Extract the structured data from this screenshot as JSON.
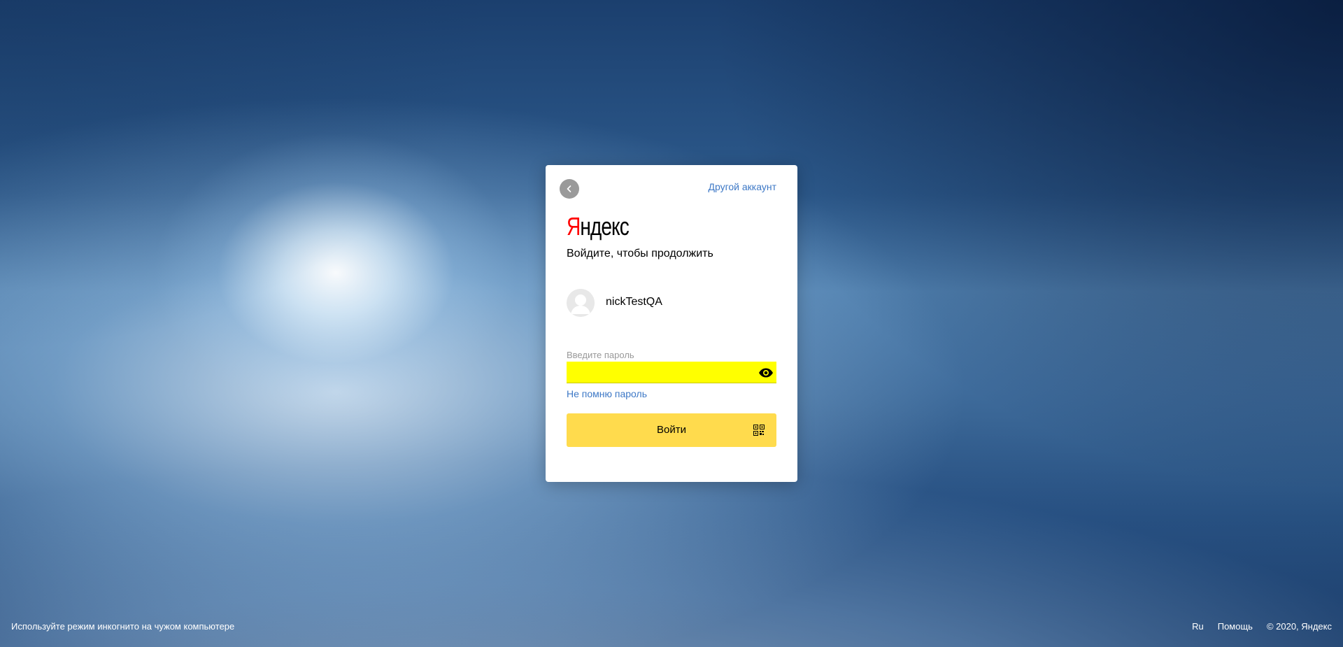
{
  "card": {
    "other_account_label": "Другой аккаунт",
    "logo": {
      "first_letter": "Я",
      "rest": "ндекс"
    },
    "subtitle": "Войдите, чтобы продолжить",
    "username": "nickTestQA",
    "password": {
      "label": "Введите пароль",
      "value": "",
      "highlight_color": "#ffff00"
    },
    "forgot_password_label": "Не помню пароль",
    "login_button_label": "Войти",
    "accent_color": "#ffdb4d",
    "link_color": "#3d78c6"
  },
  "footer": {
    "left_text": "Используйте режим инкогнито на чужом компьютере",
    "language": "Ru",
    "help": "Помощь",
    "copyright": "© 2020, Яндекс"
  },
  "icons": {
    "back": "chevron-left-icon",
    "eye": "eye-icon",
    "qr": "qr-code-icon",
    "avatar": "user-avatar-placeholder"
  }
}
